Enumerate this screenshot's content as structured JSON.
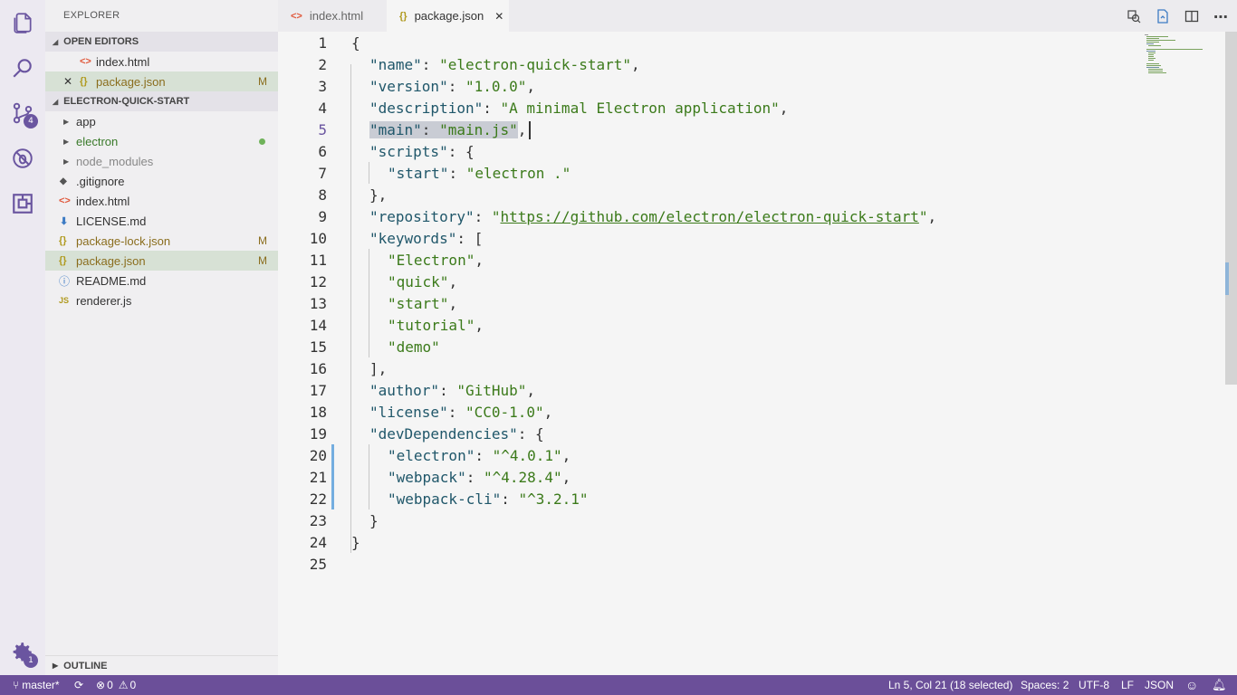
{
  "activity": {
    "scm_badge": "4",
    "settings_badge": "1"
  },
  "sidebar": {
    "title": "EXPLORER",
    "open_editors": {
      "label": "OPEN EDITORS",
      "items": [
        {
          "name": "index.html",
          "icon": "<>",
          "flag": ""
        },
        {
          "name": "package.json",
          "icon": "{}",
          "flag": "M"
        }
      ]
    },
    "project": {
      "label": "ELECTRON-QUICK-START",
      "items": [
        {
          "name": "app",
          "type": "folder",
          "flag": ""
        },
        {
          "name": "electron",
          "type": "folder",
          "flag": "dot"
        },
        {
          "name": "node_modules",
          "type": "folder",
          "flag": ""
        },
        {
          "name": ".gitignore",
          "icon": "◆",
          "flag": ""
        },
        {
          "name": "index.html",
          "icon": "<>",
          "flag": ""
        },
        {
          "name": "LICENSE.md",
          "icon": "⬇",
          "flag": ""
        },
        {
          "name": "package-lock.json",
          "icon": "{}",
          "flag": "M"
        },
        {
          "name": "package.json",
          "icon": "{}",
          "flag": "M"
        },
        {
          "name": "README.md",
          "icon": "ⓘ",
          "flag": ""
        },
        {
          "name": "renderer.js",
          "icon": "JS",
          "flag": ""
        }
      ]
    },
    "outline_label": "OUTLINE"
  },
  "tabs": [
    {
      "label": "index.html",
      "icon": "<>"
    },
    {
      "label": "package.json",
      "icon": "{}",
      "close": "✕"
    }
  ],
  "editor": {
    "lines": [
      {
        "n": "1",
        "indent": 0,
        "parts": [
          [
            "p",
            "{"
          ]
        ]
      },
      {
        "n": "2",
        "indent": 1,
        "parts": [
          [
            "k",
            "\"name\""
          ],
          [
            "p",
            ": "
          ],
          [
            "s",
            "\"electron-quick-start\""
          ],
          [
            "p",
            ","
          ]
        ]
      },
      {
        "n": "3",
        "indent": 1,
        "parts": [
          [
            "k",
            "\"version\""
          ],
          [
            "p",
            ": "
          ],
          [
            "s",
            "\"1.0.0\""
          ],
          [
            "p",
            ","
          ]
        ]
      },
      {
        "n": "4",
        "indent": 1,
        "parts": [
          [
            "k",
            "\"description\""
          ],
          [
            "p",
            ": "
          ],
          [
            "s",
            "\"A minimal Electron application\""
          ],
          [
            "p",
            ","
          ]
        ]
      },
      {
        "n": "5",
        "indent": 1,
        "parts": [
          [
            "k",
            "\"main\""
          ],
          [
            "p",
            ": "
          ],
          [
            "s",
            "\"main.js\""
          ],
          [
            "p",
            ","
          ]
        ]
      },
      {
        "n": "6",
        "indent": 1,
        "parts": [
          [
            "k",
            "\"scripts\""
          ],
          [
            "p",
            ": {"
          ]
        ]
      },
      {
        "n": "7",
        "indent": 2,
        "parts": [
          [
            "k",
            "\"start\""
          ],
          [
            "p",
            ": "
          ],
          [
            "s",
            "\"electron .\""
          ]
        ]
      },
      {
        "n": "8",
        "indent": 1,
        "parts": [
          [
            "p",
            "},"
          ]
        ]
      },
      {
        "n": "9",
        "indent": 1,
        "parts": [
          [
            "k",
            "\"repository\""
          ],
          [
            "p",
            ": "
          ],
          [
            "s",
            "\""
          ],
          [
            "u",
            "https://github.com/electron/electron-quick-start"
          ],
          [
            "s",
            "\""
          ],
          [
            "p",
            ","
          ]
        ]
      },
      {
        "n": "10",
        "indent": 1,
        "parts": [
          [
            "k",
            "\"keywords\""
          ],
          [
            "p",
            ": ["
          ]
        ]
      },
      {
        "n": "11",
        "indent": 2,
        "parts": [
          [
            "s",
            "\"Electron\""
          ],
          [
            "p",
            ","
          ]
        ]
      },
      {
        "n": "12",
        "indent": 2,
        "parts": [
          [
            "s",
            "\"quick\""
          ],
          [
            "p",
            ","
          ]
        ]
      },
      {
        "n": "13",
        "indent": 2,
        "parts": [
          [
            "s",
            "\"start\""
          ],
          [
            "p",
            ","
          ]
        ]
      },
      {
        "n": "14",
        "indent": 2,
        "parts": [
          [
            "s",
            "\"tutorial\""
          ],
          [
            "p",
            ","
          ]
        ]
      },
      {
        "n": "15",
        "indent": 2,
        "parts": [
          [
            "s",
            "\"demo\""
          ]
        ]
      },
      {
        "n": "16",
        "indent": 1,
        "parts": [
          [
            "p",
            "],"
          ]
        ]
      },
      {
        "n": "17",
        "indent": 1,
        "parts": [
          [
            "k",
            "\"author\""
          ],
          [
            "p",
            ": "
          ],
          [
            "s",
            "\"GitHub\""
          ],
          [
            "p",
            ","
          ]
        ]
      },
      {
        "n": "18",
        "indent": 1,
        "parts": [
          [
            "k",
            "\"license\""
          ],
          [
            "p",
            ": "
          ],
          [
            "s",
            "\"CC0-1.0\""
          ],
          [
            "p",
            ","
          ]
        ]
      },
      {
        "n": "19",
        "indent": 1,
        "parts": [
          [
            "k",
            "\"devDependencies\""
          ],
          [
            "p",
            ": {"
          ]
        ]
      },
      {
        "n": "20",
        "indent": 2,
        "parts": [
          [
            "k",
            "\"electron\""
          ],
          [
            "p",
            ": "
          ],
          [
            "s",
            "\"^4.0.1\""
          ],
          [
            "p",
            ","
          ]
        ]
      },
      {
        "n": "21",
        "indent": 2,
        "parts": [
          [
            "k",
            "\"webpack\""
          ],
          [
            "p",
            ": "
          ],
          [
            "s",
            "\"^4.28.4\""
          ],
          [
            "p",
            ","
          ]
        ]
      },
      {
        "n": "22",
        "indent": 2,
        "parts": [
          [
            "k",
            "\"webpack-cli\""
          ],
          [
            "p",
            ": "
          ],
          [
            "s",
            "\"^3.2.1\""
          ]
        ]
      },
      {
        "n": "23",
        "indent": 1,
        "parts": [
          [
            "p",
            "}"
          ]
        ]
      },
      {
        "n": "24",
        "indent": 0,
        "parts": [
          [
            "p",
            "}"
          ]
        ]
      },
      {
        "n": "25",
        "indent": 0,
        "parts": []
      }
    ],
    "current_line": "5",
    "modified_lines": [
      "20",
      "21",
      "22"
    ]
  },
  "status": {
    "branch": "master*",
    "errors": "0",
    "warnings": "0",
    "position": "Ln 5, Col 21 (18 selected)",
    "spaces": "Spaces: 2",
    "encoding": "UTF-8",
    "eol": "LF",
    "language": "JSON"
  },
  "colors": {
    "accent": "#6b4f99",
    "selected_row": "#d7e1d5",
    "string": "#3b7a1a",
    "key": "#20576a"
  }
}
